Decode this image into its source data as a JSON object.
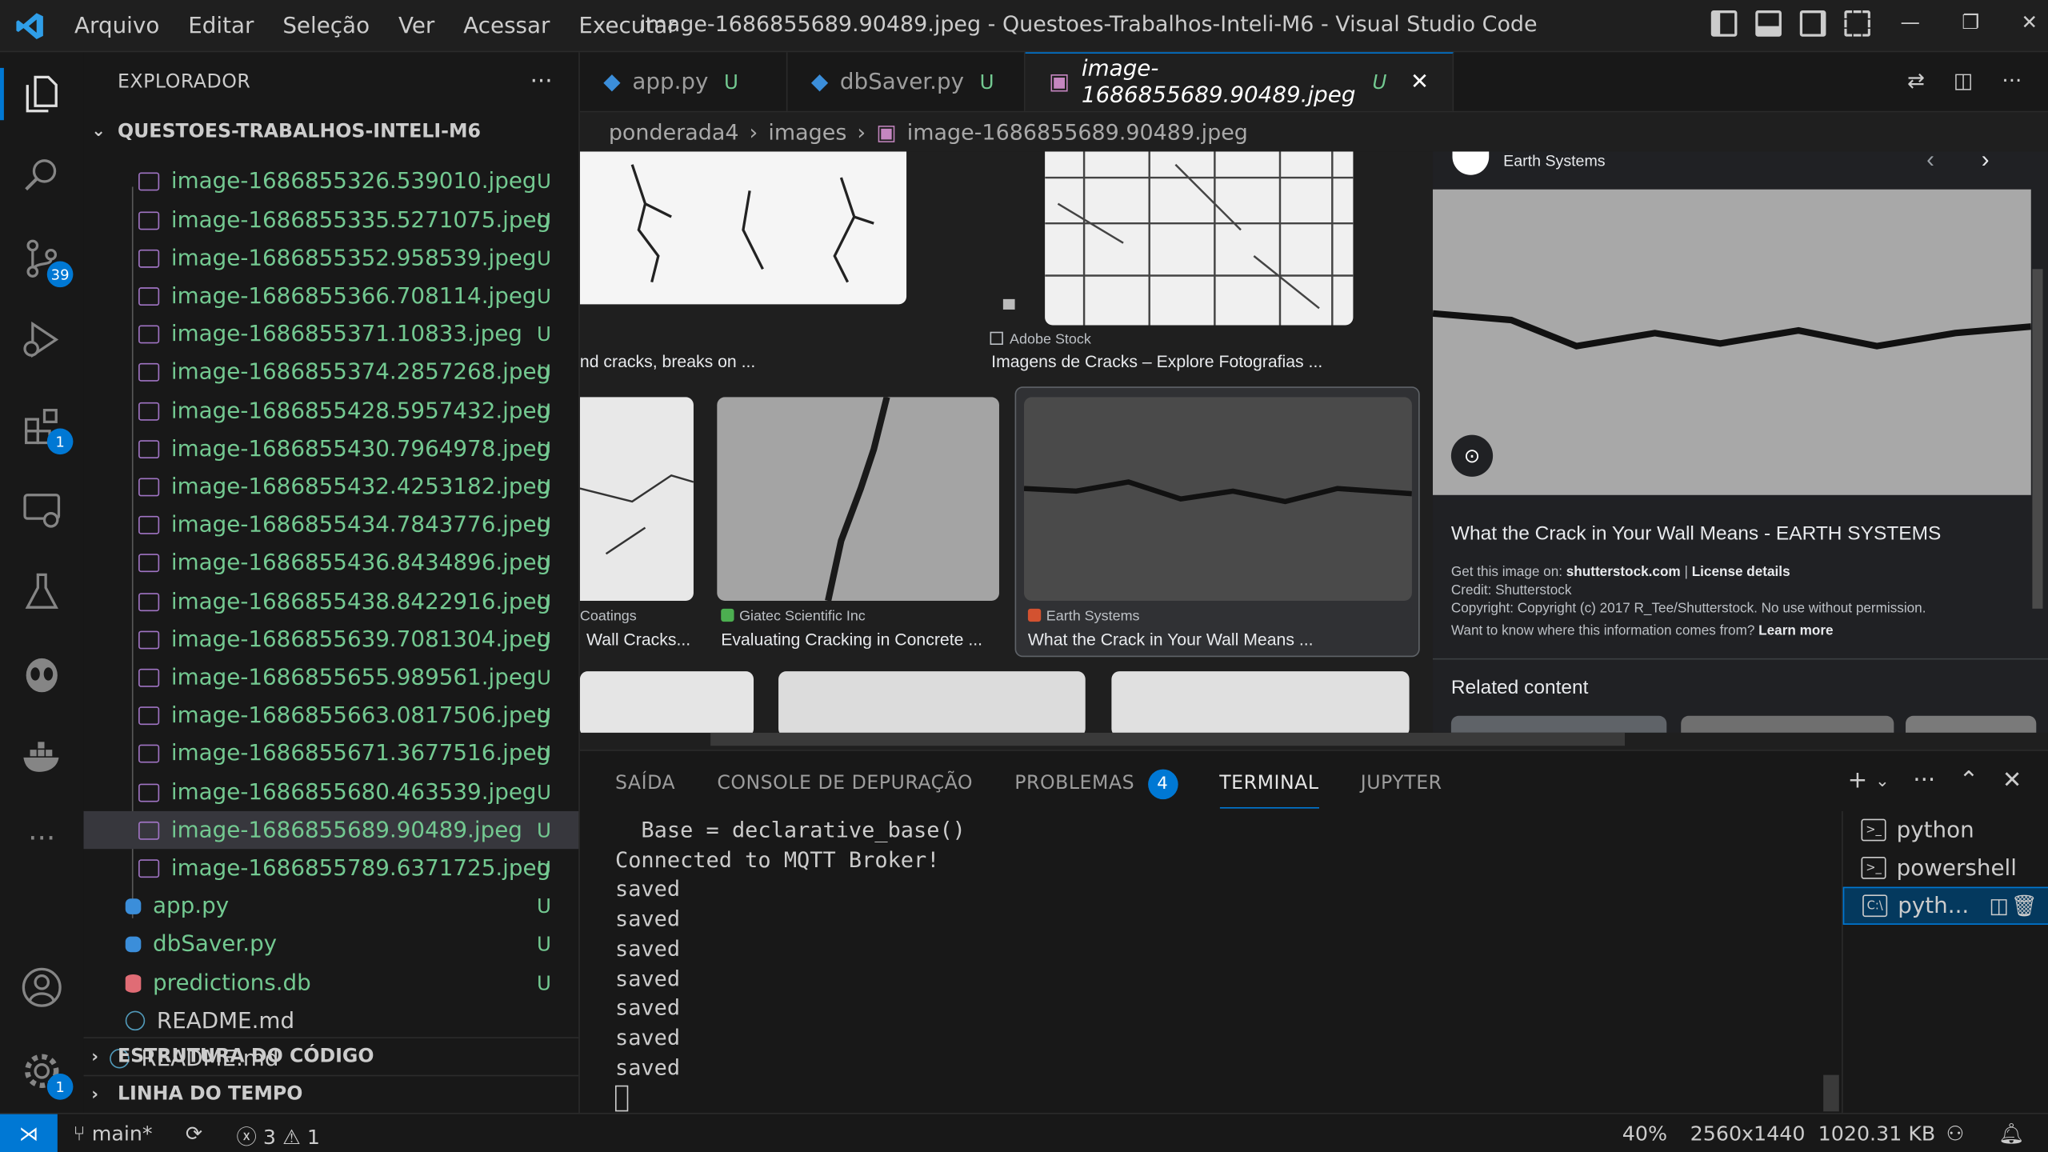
{
  "menu": [
    "Arquivo",
    "Editar",
    "Seleção",
    "Ver",
    "Acessar",
    "Executar"
  ],
  "window_title": "image-1686855689.90489.jpeg - Questoes-Trabalhos-Inteli-M6 - Visual Studio Code",
  "activity": {
    "source_control_badge": "39",
    "extensions_badge": "1",
    "settings_badge": "1"
  },
  "sidebar": {
    "title": "EXPLORADOR",
    "root": "QUESTOES-TRABALHOS-INTELI-M6",
    "partial_file": "image-1686855326.539010.jpeg",
    "files": [
      {
        "name": "image-1686855335.5271075.jpeg",
        "status": "U"
      },
      {
        "name": "image-1686855352.958539.jpeg",
        "status": "U"
      },
      {
        "name": "image-1686855366.708114.jpeg",
        "status": "U"
      },
      {
        "name": "image-1686855371.10833.jpeg",
        "status": "U"
      },
      {
        "name": "image-1686855374.2857268.jpeg",
        "status": "U"
      },
      {
        "name": "image-1686855428.5957432.jpeg",
        "status": "U"
      },
      {
        "name": "image-1686855430.7964978.jpeg",
        "status": "U"
      },
      {
        "name": "image-1686855432.4253182.jpeg",
        "status": "U"
      },
      {
        "name": "image-1686855434.7843776.jpeg",
        "status": "U"
      },
      {
        "name": "image-1686855436.8434896.jpeg",
        "status": "U"
      },
      {
        "name": "image-1686855438.8422916.jpeg",
        "status": "U"
      },
      {
        "name": "image-1686855639.7081304.jpeg",
        "status": "U"
      },
      {
        "name": "image-1686855655.989561.jpeg",
        "status": "U"
      },
      {
        "name": "image-1686855663.0817506.jpeg",
        "status": "U"
      },
      {
        "name": "image-1686855671.3677516.jpeg",
        "status": "U"
      },
      {
        "name": "image-1686855680.463539.jpeg",
        "status": "U"
      },
      {
        "name": "image-1686855689.90489.jpeg",
        "status": "U"
      },
      {
        "name": "image-1686855789.6371725.jpeg",
        "status": "U"
      }
    ],
    "folder_files": [
      {
        "name": "app.py",
        "status": "U"
      },
      {
        "name": "dbSaver.py",
        "status": "U"
      },
      {
        "name": "predictions.db",
        "status": "U"
      },
      {
        "name": "README.md",
        "status": ""
      }
    ],
    "root_readme": "README.md",
    "outline": "ESTRUTURA DO CÓDIGO",
    "timeline": "LINHA DO TEMPO"
  },
  "tabs": [
    {
      "label": "app.py",
      "status": "U"
    },
    {
      "label": "dbSaver.py",
      "status": "U"
    },
    {
      "label": "image-1686855689.90489.jpeg",
      "status": "U"
    }
  ],
  "breadcrumb": [
    "ponderada4",
    "images",
    "image-1686855689.90489.jpeg"
  ],
  "viewer": {
    "cap1_title": "nd cracks, breaks on ...",
    "cap2_source": "Adobe Stock",
    "cap2_title": "Imagens de Cracks – Explore Fotografias ...",
    "cap3_source": "Coatings",
    "cap3_title": "Wall Cracks...",
    "cap4_source": "Giatec Scientific Inc",
    "cap4_title": "Evaluating Cracking in Concrete ...",
    "cap5_source": "Earth Systems",
    "cap5_title": "What the Crack in Your Wall Means ...",
    "panel_source": "Earth Systems",
    "panel_title": "What the Crack in Your Wall Means - EARTH SYSTEMS",
    "get_image": "Get this image on:",
    "get_image_site": "shutterstock.com",
    "pipe": "|",
    "license": "License details",
    "credit": "Credit: Shutterstock",
    "copyright": "Copyright: Copyright (c) 2017 R_Tee/Shutterstock. No use without permission.",
    "want_to_know": "Want to know where this information comes from?",
    "learn_more": "Learn more",
    "related": "Related content"
  },
  "panel": {
    "tabs": [
      "SAÍDA",
      "CONSOLE DE DEPURAÇÃO",
      "PROBLEMAS",
      "TERMINAL",
      "JUPYTER"
    ],
    "problems_count": "4",
    "terminal_lines": [
      "  Base = declarative_base()",
      "Connected to MQTT Broker!",
      "saved",
      "saved",
      "saved",
      "saved",
      "saved",
      "saved",
      "saved"
    ],
    "terminals": [
      "python",
      "powershell",
      "pyth..."
    ]
  },
  "status": {
    "branch": "main*",
    "errors": "3",
    "warnings": "1",
    "zoom": "40%",
    "dimensions": "2560x1440",
    "size": "1020.31 KB"
  }
}
